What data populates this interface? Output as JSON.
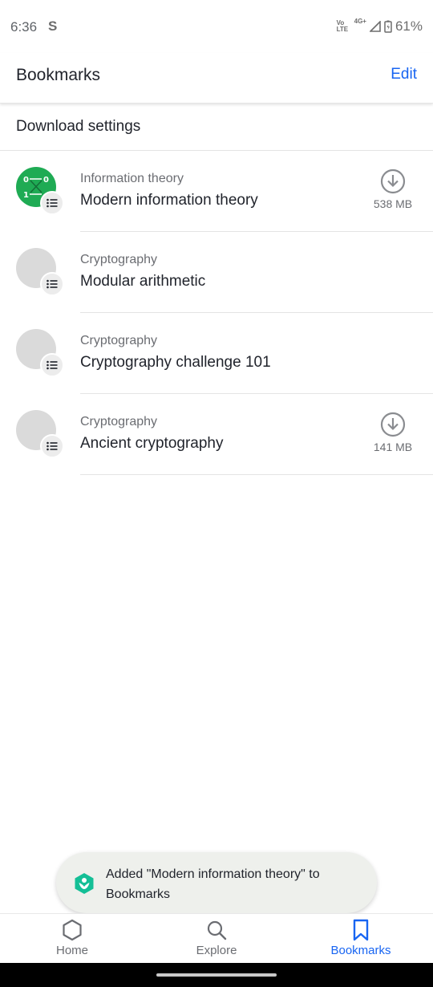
{
  "status_bar": {
    "time": "6:36",
    "s_glyph": "S",
    "network": "4G+",
    "volte": "Vo LTE",
    "battery": "61%"
  },
  "app_bar": {
    "title": "Bookmarks",
    "edit_label": "Edit"
  },
  "download_settings": {
    "label": "Download settings"
  },
  "bookmarks": [
    {
      "subject": "Information theory",
      "title": "Modern information theory",
      "size": "538 MB",
      "downloadable": true,
      "thumb": "green-binary"
    },
    {
      "subject": "Cryptography",
      "title": "Modular arithmetic",
      "size": "",
      "downloadable": false,
      "thumb": "gray"
    },
    {
      "subject": "Cryptography",
      "title": "Cryptography challenge 101",
      "size": "",
      "downloadable": false,
      "thumb": "gray"
    },
    {
      "subject": "Cryptography",
      "title": "Ancient cryptography",
      "size": "141 MB",
      "downloadable": true,
      "thumb": "gray"
    }
  ],
  "toast": {
    "message": "Added \"Modern information theory\" to Bookmarks",
    "icon": "khan-academy-logo-icon"
  },
  "bottom_nav": [
    {
      "label": "Home",
      "icon": "hexagon-home-icon",
      "active": false
    },
    {
      "label": "Explore",
      "icon": "search-icon",
      "active": false
    },
    {
      "label": "Bookmarks",
      "icon": "bookmark-icon",
      "active": true
    }
  ],
  "colors": {
    "accent": "#1865f2",
    "thumb_green": "#1fab54",
    "thumb_gray": "#dadada"
  }
}
